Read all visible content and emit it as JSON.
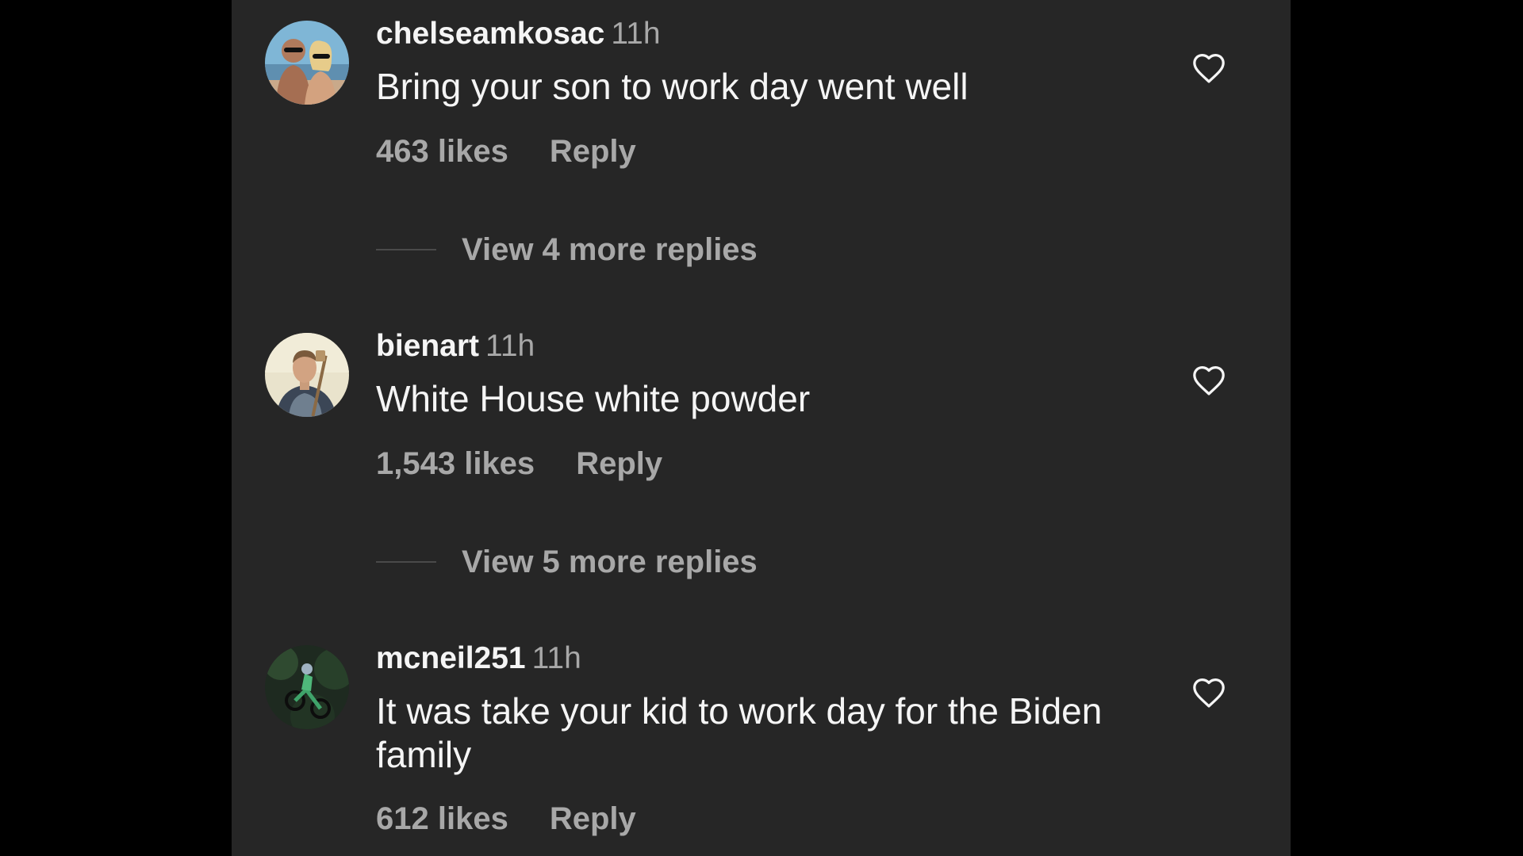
{
  "comments": [
    {
      "username": "chelseamkosac",
      "time": "11h",
      "text": "Bring your son to work day went well",
      "likes": "463 likes",
      "reply_label": "Reply",
      "view_replies": "View 4 more replies",
      "liked": false
    },
    {
      "username": "bienart",
      "time": "11h",
      "text": "White House white powder",
      "likes": "1,543 likes",
      "reply_label": "Reply",
      "view_replies": "View 5 more replies",
      "liked": false
    },
    {
      "username": "mcneil251",
      "time": "11h",
      "text": "It was take your kid to work day for the Biden family",
      "likes": "612 likes",
      "reply_label": "Reply",
      "liked": false
    }
  ],
  "icons": {
    "heart": "heart-outline-icon",
    "avatar": "user-avatar"
  },
  "colors": {
    "background": "#262626",
    "outer_background": "#000000",
    "primary_text": "#f5f5f5",
    "secondary_text": "#a8a8a8"
  }
}
